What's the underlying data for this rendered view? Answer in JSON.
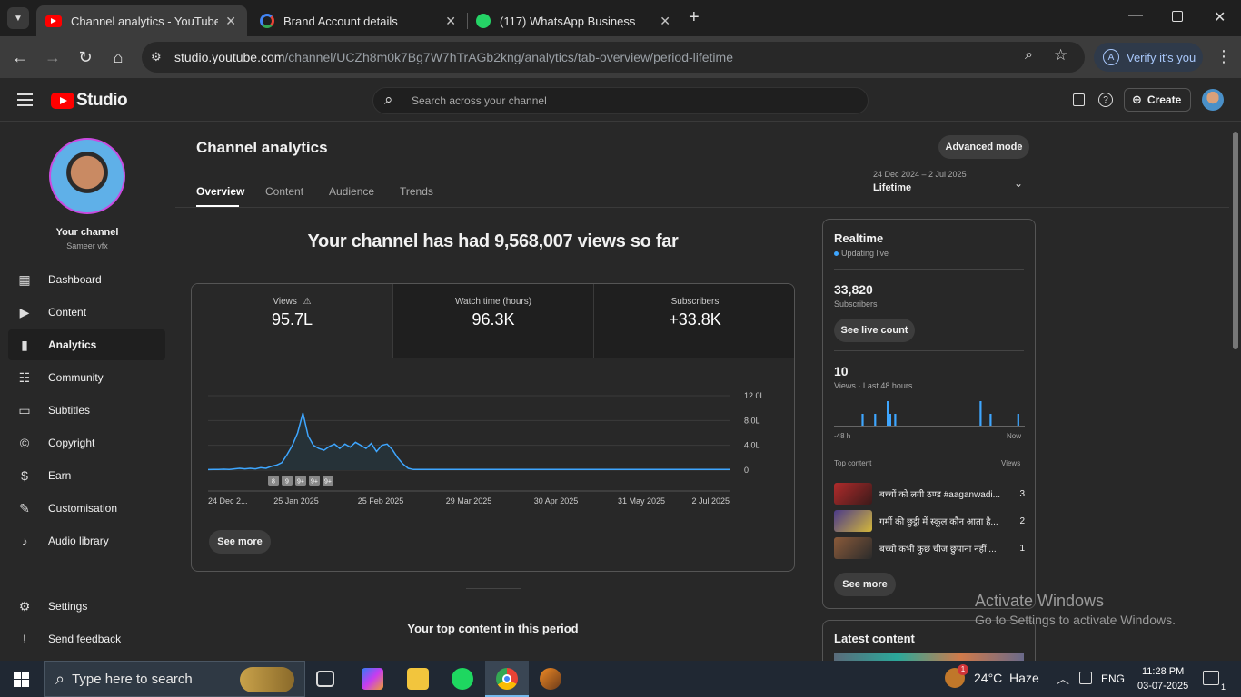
{
  "browser": {
    "tabs": [
      {
        "title": "Channel analytics - YouTube Studio",
        "icon": "youtube-icon"
      },
      {
        "title": "Brand Account details",
        "icon": "google-icon"
      },
      {
        "title": "(117) WhatsApp Business",
        "icon": "whatsapp-icon"
      }
    ],
    "url_host": "studio.youtube.com",
    "url_path": "/channel/UCZh8m0k7Bg7W7hTrAGb2kng/analytics/tab-overview/period-lifetime",
    "verify_label": "Verify it's you"
  },
  "header": {
    "logo_text": "Studio",
    "search_placeholder": "Search across your channel",
    "create_label": "Create"
  },
  "sidebar": {
    "channel_title": "Your channel",
    "channel_name": "Sameer vfx",
    "items": [
      {
        "label": "Dashboard",
        "icon": "dashboard-icon"
      },
      {
        "label": "Content",
        "icon": "content-icon"
      },
      {
        "label": "Analytics",
        "icon": "analytics-icon"
      },
      {
        "label": "Community",
        "icon": "community-icon"
      },
      {
        "label": "Subtitles",
        "icon": "subtitles-icon"
      },
      {
        "label": "Copyright",
        "icon": "copyright-icon"
      },
      {
        "label": "Earn",
        "icon": "earn-icon"
      },
      {
        "label": "Customisation",
        "icon": "customisation-icon"
      },
      {
        "label": "Audio library",
        "icon": "audio-library-icon"
      }
    ],
    "bottom_items": [
      {
        "label": "Settings",
        "icon": "settings-icon"
      },
      {
        "label": "Send feedback",
        "icon": "feedback-icon"
      }
    ]
  },
  "main": {
    "page_title": "Channel analytics",
    "advanced_mode_label": "Advanced mode",
    "tabs": [
      "Overview",
      "Content",
      "Audience",
      "Trends"
    ],
    "period_range": "24 Dec 2024 – 2 Jul 2025",
    "period_label": "Lifetime",
    "headline": "Your channel has had 9,568,007 views so far",
    "metrics": [
      {
        "label": "Views",
        "value": "95.7L"
      },
      {
        "label": "Watch time (hours)",
        "value": "96.3K"
      },
      {
        "label": "Subscribers",
        "value": "+33.8K"
      }
    ],
    "see_more_label": "See more",
    "top_content_heading": "Your top content in this period"
  },
  "chart_data": {
    "type": "area",
    "series": [
      {
        "values": [
          0.1,
          0.1,
          0.1,
          0.15,
          0.1,
          0.2,
          0.3,
          0.2,
          0.3,
          0.2,
          0.4,
          0.3,
          0.6,
          0.8,
          1.2,
          2.5,
          4.0,
          6.0,
          9.2,
          5.5,
          4.0,
          3.5,
          3.2,
          3.8,
          4.2,
          3.5,
          4.2,
          3.7,
          4.5,
          4.0,
          3.5,
          4.3,
          3.0,
          4.0,
          4.2,
          3.3,
          2.0,
          1.0,
          0.3,
          0.1,
          0.1,
          0.1,
          0.1,
          0.1,
          0.1,
          0.1,
          0.1,
          0.1,
          0.1,
          0.1,
          0.1,
          0.1,
          0.1,
          0.1,
          0.1,
          0.1,
          0.1,
          0.1,
          0.1,
          0.1,
          0.1,
          0.1,
          0.1,
          0.1,
          0.1,
          0.1,
          0.1,
          0.1,
          0.1,
          0.1,
          0.1,
          0.1,
          0.1,
          0.1,
          0.1,
          0.1,
          0.1,
          0.1,
          0.1,
          0.1,
          0.1,
          0.1,
          0.1,
          0.1,
          0.1,
          0.1,
          0.1,
          0.1,
          0.1,
          0.1,
          0.1,
          0.1,
          0.1,
          0.1,
          0.1,
          0.1,
          0.1,
          0.1,
          0.1,
          0.1
        ]
      }
    ],
    "x_tick_labels": [
      "24 Dec 2...",
      "25 Jan 2025",
      "25 Feb 2025",
      "29 Mar 2025",
      "30 Apr 2025",
      "31 May 2025",
      "2 Jul 2025"
    ],
    "y_tick_labels": [
      "12.0L",
      "8.0L",
      "4.0L",
      "0"
    ],
    "ylim": [
      0,
      12
    ],
    "markers": [
      "8",
      "9",
      "9+",
      "9+",
      "9+"
    ],
    "grid": true
  },
  "realtime": {
    "title": "Realtime",
    "status": "Updating live",
    "subscribers_value": "33,820",
    "subscribers_label": "Subscribers",
    "see_live_label": "See live count",
    "views_value": "10",
    "views_label": "Views · Last 48 hours",
    "bars": [
      0,
      0,
      0,
      0,
      0,
      0,
      0,
      0,
      0,
      0,
      0,
      1,
      0,
      0,
      0,
      0,
      1,
      0,
      0,
      0,
      0,
      2,
      1,
      0,
      1,
      0,
      0,
      0,
      0,
      0,
      0,
      0,
      0,
      0,
      0,
      0,
      0,
      0,
      0,
      0,
      0,
      0,
      0,
      0,
      0,
      0,
      0,
      0,
      0,
      0,
      0,
      0,
      0,
      0,
      0,
      0,
      0,
      0,
      2,
      0,
      0,
      0,
      1,
      0,
      0,
      0,
      0,
      0,
      0,
      0,
      0,
      0,
      0,
      1,
      0,
      0
    ],
    "axis_start": "-48 h",
    "axis_end": "Now",
    "top_content_label": "Top content",
    "top_content_views_label": "Views",
    "top_content": [
      {
        "title": "बच्चों को लगी ठण्ड #aaganwadi...",
        "views": "3"
      },
      {
        "title": "गर्मी की छुट्टी में स्कूल कौन आता है...",
        "views": "2"
      },
      {
        "title": "बच्चो कभी कुछ चीज छुपाना नहीं ...",
        "views": "1"
      }
    ],
    "see_more_label": "See more"
  },
  "latest": {
    "title": "Latest content"
  },
  "watermark": {
    "line1": "Activate Windows",
    "line2": "Go to Settings to activate Windows."
  },
  "taskbar": {
    "search_placeholder": "Type here to search",
    "weather": "24°C  Haze",
    "lang": "ENG",
    "time": "11:28 PM",
    "date": "03-07-2025",
    "weather_badge": "1",
    "notif_badge": "1"
  },
  "colors": {
    "accent": "#3ea6ff",
    "youtube_red": "#ff0000",
    "chart_fill": "#263238"
  }
}
